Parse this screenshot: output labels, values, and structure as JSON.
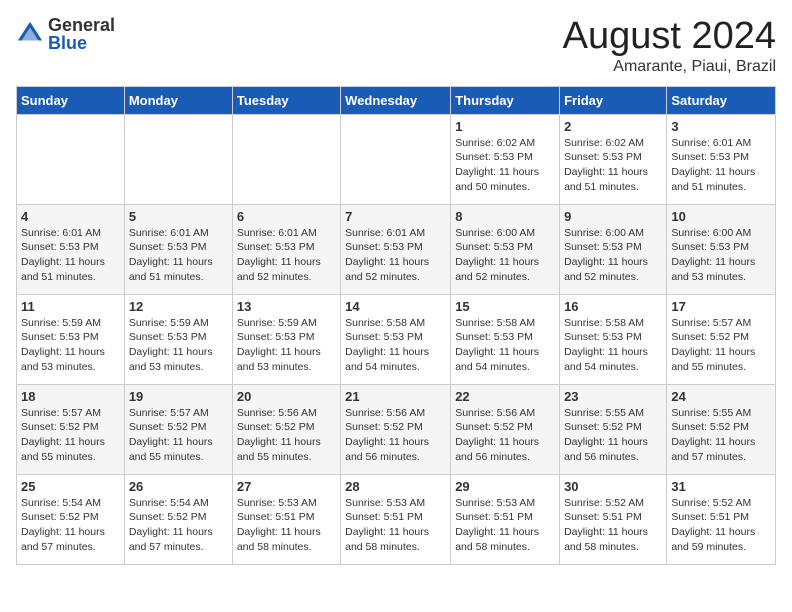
{
  "logo": {
    "general": "General",
    "blue": "Blue"
  },
  "title": "August 2024",
  "subtitle": "Amarante, Piaui, Brazil",
  "days_of_week": [
    "Sunday",
    "Monday",
    "Tuesday",
    "Wednesday",
    "Thursday",
    "Friday",
    "Saturday"
  ],
  "weeks": [
    [
      {
        "day": "",
        "sunrise": "",
        "sunset": "",
        "daylight": ""
      },
      {
        "day": "",
        "sunrise": "",
        "sunset": "",
        "daylight": ""
      },
      {
        "day": "",
        "sunrise": "",
        "sunset": "",
        "daylight": ""
      },
      {
        "day": "",
        "sunrise": "",
        "sunset": "",
        "daylight": ""
      },
      {
        "day": "1",
        "sunrise": "Sunrise: 6:02 AM",
        "sunset": "Sunset: 5:53 PM",
        "daylight": "Daylight: 11 hours and 50 minutes."
      },
      {
        "day": "2",
        "sunrise": "Sunrise: 6:02 AM",
        "sunset": "Sunset: 5:53 PM",
        "daylight": "Daylight: 11 hours and 51 minutes."
      },
      {
        "day": "3",
        "sunrise": "Sunrise: 6:01 AM",
        "sunset": "Sunset: 5:53 PM",
        "daylight": "Daylight: 11 hours and 51 minutes."
      }
    ],
    [
      {
        "day": "4",
        "sunrise": "Sunrise: 6:01 AM",
        "sunset": "Sunset: 5:53 PM",
        "daylight": "Daylight: 11 hours and 51 minutes."
      },
      {
        "day": "5",
        "sunrise": "Sunrise: 6:01 AM",
        "sunset": "Sunset: 5:53 PM",
        "daylight": "Daylight: 11 hours and 51 minutes."
      },
      {
        "day": "6",
        "sunrise": "Sunrise: 6:01 AM",
        "sunset": "Sunset: 5:53 PM",
        "daylight": "Daylight: 11 hours and 52 minutes."
      },
      {
        "day": "7",
        "sunrise": "Sunrise: 6:01 AM",
        "sunset": "Sunset: 5:53 PM",
        "daylight": "Daylight: 11 hours and 52 minutes."
      },
      {
        "day": "8",
        "sunrise": "Sunrise: 6:00 AM",
        "sunset": "Sunset: 5:53 PM",
        "daylight": "Daylight: 11 hours and 52 minutes."
      },
      {
        "day": "9",
        "sunrise": "Sunrise: 6:00 AM",
        "sunset": "Sunset: 5:53 PM",
        "daylight": "Daylight: 11 hours and 52 minutes."
      },
      {
        "day": "10",
        "sunrise": "Sunrise: 6:00 AM",
        "sunset": "Sunset: 5:53 PM",
        "daylight": "Daylight: 11 hours and 53 minutes."
      }
    ],
    [
      {
        "day": "11",
        "sunrise": "Sunrise: 5:59 AM",
        "sunset": "Sunset: 5:53 PM",
        "daylight": "Daylight: 11 hours and 53 minutes."
      },
      {
        "day": "12",
        "sunrise": "Sunrise: 5:59 AM",
        "sunset": "Sunset: 5:53 PM",
        "daylight": "Daylight: 11 hours and 53 minutes."
      },
      {
        "day": "13",
        "sunrise": "Sunrise: 5:59 AM",
        "sunset": "Sunset: 5:53 PM",
        "daylight": "Daylight: 11 hours and 53 minutes."
      },
      {
        "day": "14",
        "sunrise": "Sunrise: 5:58 AM",
        "sunset": "Sunset: 5:53 PM",
        "daylight": "Daylight: 11 hours and 54 minutes."
      },
      {
        "day": "15",
        "sunrise": "Sunrise: 5:58 AM",
        "sunset": "Sunset: 5:53 PM",
        "daylight": "Daylight: 11 hours and 54 minutes."
      },
      {
        "day": "16",
        "sunrise": "Sunrise: 5:58 AM",
        "sunset": "Sunset: 5:53 PM",
        "daylight": "Daylight: 11 hours and 54 minutes."
      },
      {
        "day": "17",
        "sunrise": "Sunrise: 5:57 AM",
        "sunset": "Sunset: 5:52 PM",
        "daylight": "Daylight: 11 hours and 55 minutes."
      }
    ],
    [
      {
        "day": "18",
        "sunrise": "Sunrise: 5:57 AM",
        "sunset": "Sunset: 5:52 PM",
        "daylight": "Daylight: 11 hours and 55 minutes."
      },
      {
        "day": "19",
        "sunrise": "Sunrise: 5:57 AM",
        "sunset": "Sunset: 5:52 PM",
        "daylight": "Daylight: 11 hours and 55 minutes."
      },
      {
        "day": "20",
        "sunrise": "Sunrise: 5:56 AM",
        "sunset": "Sunset: 5:52 PM",
        "daylight": "Daylight: 11 hours and 55 minutes."
      },
      {
        "day": "21",
        "sunrise": "Sunrise: 5:56 AM",
        "sunset": "Sunset: 5:52 PM",
        "daylight": "Daylight: 11 hours and 56 minutes."
      },
      {
        "day": "22",
        "sunrise": "Sunrise: 5:56 AM",
        "sunset": "Sunset: 5:52 PM",
        "daylight": "Daylight: 11 hours and 56 minutes."
      },
      {
        "day": "23",
        "sunrise": "Sunrise: 5:55 AM",
        "sunset": "Sunset: 5:52 PM",
        "daylight": "Daylight: 11 hours and 56 minutes."
      },
      {
        "day": "24",
        "sunrise": "Sunrise: 5:55 AM",
        "sunset": "Sunset: 5:52 PM",
        "daylight": "Daylight: 11 hours and 57 minutes."
      }
    ],
    [
      {
        "day": "25",
        "sunrise": "Sunrise: 5:54 AM",
        "sunset": "Sunset: 5:52 PM",
        "daylight": "Daylight: 11 hours and 57 minutes."
      },
      {
        "day": "26",
        "sunrise": "Sunrise: 5:54 AM",
        "sunset": "Sunset: 5:52 PM",
        "daylight": "Daylight: 11 hours and 57 minutes."
      },
      {
        "day": "27",
        "sunrise": "Sunrise: 5:53 AM",
        "sunset": "Sunset: 5:51 PM",
        "daylight": "Daylight: 11 hours and 58 minutes."
      },
      {
        "day": "28",
        "sunrise": "Sunrise: 5:53 AM",
        "sunset": "Sunset: 5:51 PM",
        "daylight": "Daylight: 11 hours and 58 minutes."
      },
      {
        "day": "29",
        "sunrise": "Sunrise: 5:53 AM",
        "sunset": "Sunset: 5:51 PM",
        "daylight": "Daylight: 11 hours and 58 minutes."
      },
      {
        "day": "30",
        "sunrise": "Sunrise: 5:52 AM",
        "sunset": "Sunset: 5:51 PM",
        "daylight": "Daylight: 11 hours and 58 minutes."
      },
      {
        "day": "31",
        "sunrise": "Sunrise: 5:52 AM",
        "sunset": "Sunset: 5:51 PM",
        "daylight": "Daylight: 11 hours and 59 minutes."
      }
    ]
  ]
}
